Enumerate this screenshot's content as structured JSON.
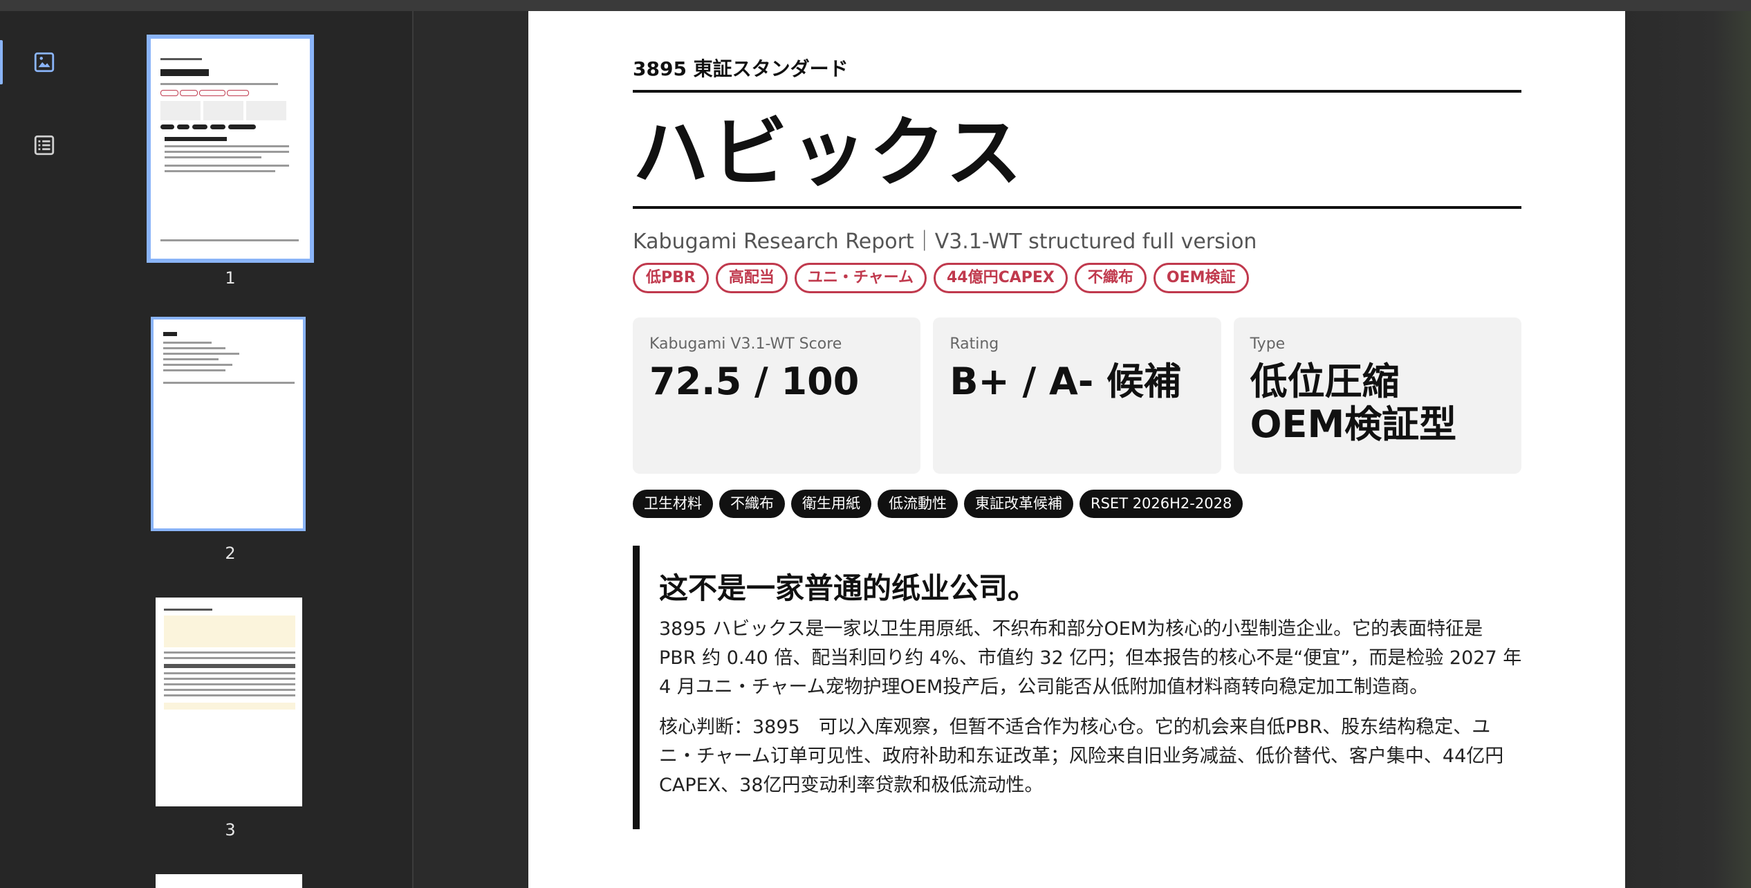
{
  "thumbnails": [
    {
      "page": "1"
    },
    {
      "page": "2"
    },
    {
      "page": "3"
    }
  ],
  "icons": {
    "rail_thumbnails": "image-icon",
    "rail_outline": "list-icon"
  },
  "document": {
    "code_line": "3895 東証スタンダード",
    "title": "ハビックス",
    "subtitle": "Kabugami Research Report｜V3.1-WT structured full version",
    "pills": [
      "低PBR",
      "高配当",
      "ユニ・チャーム",
      "44億円CAPEX",
      "不織布",
      "OEM検証"
    ],
    "cards": [
      {
        "label": "Kabugami V3.1-WT Score",
        "value": [
          "72.5 / 100"
        ]
      },
      {
        "label": "Rating",
        "value": [
          "B+ / A- 候補"
        ]
      },
      {
        "label": "Type",
        "value": [
          "低位圧縮",
          "OEM検証型"
        ]
      }
    ],
    "tags": [
      "卫生材料",
      "不織布",
      "衛生用紙",
      "低流動性",
      "東証改革候補",
      "RSET 2026H2-2028"
    ],
    "quote": {
      "title": "这不是一家普通的纸业公司。",
      "para1": "3895 ハビックス是一家以卫生用原纸、不织布和部分OEM为核心的小型制造企业。它的表面特征是 PBR 约 0.40 倍、配当利回り约 4%、市值约 32 亿円；但本报告的核心不是“便宜”，而是检验 2027 年 4 月ユニ・チャーム宠物护理OEM投产后，公司能否从低附加值材料商转向稳定加工制造商。",
      "para2": "核心判断：3895　可以入库观察，但暂不适合作为核心仓。它的机会来自低PBR、股东结构稳定、ユニ・チャーム订单可见性、政府补助和东证改革；风险来自旧业务减益、低价替代、客户集中、44亿円 CAPEX、38亿円变动利率贷款和极低流动性。"
    }
  },
  "colors": {
    "accent_red": "#c0394d",
    "thumb_select": "#8ab4f8",
    "card_bg": "#f2f2f2"
  }
}
